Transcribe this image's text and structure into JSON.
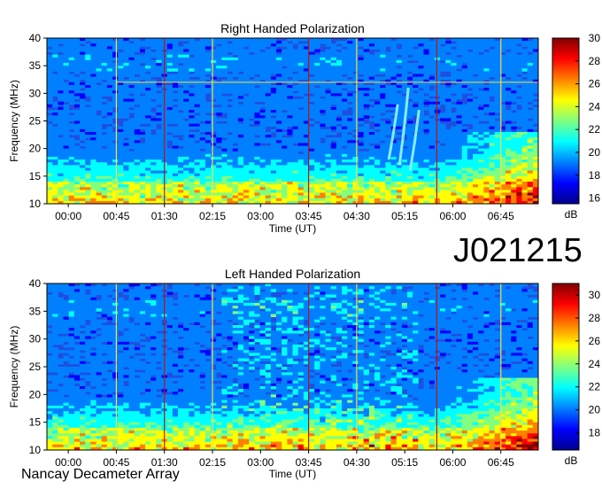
{
  "observation_id": "J021215",
  "instrument": "Nancay Decameter Array",
  "colorbar_unit": "dB",
  "palette": [
    "#00008f",
    "#0000ff",
    "#0080ff",
    "#00ffff",
    "#80ff80",
    "#ffff00",
    "#ff8000",
    "#ff0000",
    "#800000"
  ],
  "chart_data": [
    {
      "type": "heatmap",
      "title": "Right Handed Polarization",
      "xlabel": "Time (UT)",
      "ylabel": "Frequency (MHz)",
      "x_ticks": [
        "00:00",
        "00:45",
        "01:30",
        "02:15",
        "03:00",
        "03:45",
        "04:30",
        "05:15",
        "06:00",
        "06:45"
      ],
      "y_ticks": [
        "10",
        "15",
        "20",
        "25",
        "30",
        "35",
        "40"
      ],
      "ylim": [
        10,
        40
      ],
      "colorbar": {
        "label": "dB",
        "ticks": [
          "16",
          "18",
          "20",
          "22",
          "24",
          "26",
          "28",
          "30"
        ],
        "range": [
          15.5,
          30
        ]
      },
      "vertical_markers_ut": [
        "00:45",
        "01:30",
        "02:15",
        "03:45",
        "04:30",
        "05:45",
        "06:45"
      ],
      "bursts": [
        {
          "t": "05:05",
          "f_low": 18,
          "f_high": 28
        },
        {
          "t": "05:15",
          "f_low": 17,
          "f_high": 31
        },
        {
          "t": "05:25",
          "f_low": 16,
          "f_high": 27
        }
      ]
    },
    {
      "type": "heatmap",
      "title": "Left Handed Polarization",
      "xlabel": "Time (UT)",
      "ylabel": "Frequency (MHz)",
      "x_ticks": [
        "00:00",
        "00:45",
        "01:30",
        "02:15",
        "03:00",
        "03:45",
        "04:30",
        "05:15",
        "06:00",
        "06:45"
      ],
      "y_ticks": [
        "10",
        "15",
        "20",
        "25",
        "30",
        "35",
        "40"
      ],
      "ylim": [
        10,
        40
      ],
      "colorbar": {
        "label": "dB",
        "ticks": [
          "18",
          "20",
          "22",
          "24",
          "26",
          "28",
          "30"
        ],
        "range": [
          16.5,
          31
        ]
      },
      "vertical_markers_ut": [
        "00:45",
        "01:30",
        "02:15",
        "03:45",
        "04:30",
        "05:45",
        "06:45"
      ],
      "bursts": []
    }
  ]
}
